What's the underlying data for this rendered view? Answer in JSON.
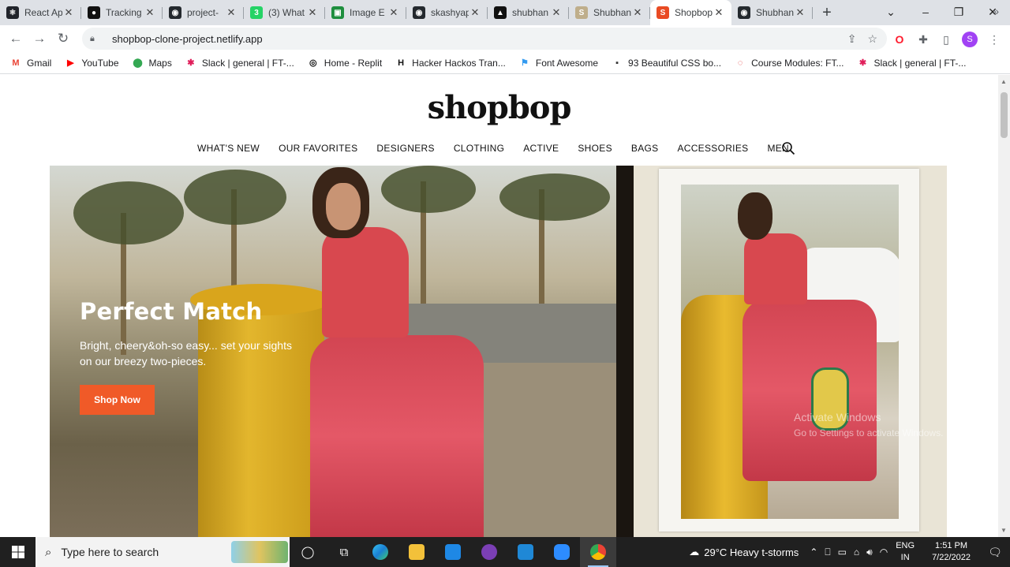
{
  "browser": {
    "tabs": [
      {
        "title": "React App",
        "color": "#20232a",
        "glyph": "⚛"
      },
      {
        "title": "Tracking",
        "color": "#111111",
        "glyph": "●"
      },
      {
        "title": "project-",
        "color": "#24292e",
        "glyph": "◉"
      },
      {
        "title": "(3) What",
        "color": "#25d366",
        "glyph": "3"
      },
      {
        "title": "Image E",
        "color": "#1e8e3e",
        "glyph": "▣"
      },
      {
        "title": "skashyap",
        "color": "#24292e",
        "glyph": "◉"
      },
      {
        "title": "shubhan",
        "color": "#111111",
        "glyph": "▲"
      },
      {
        "title": "Shubhan",
        "color": "#bfae8b",
        "glyph": "S"
      },
      {
        "title": "Shopbop",
        "color": "#e94b24",
        "glyph": "S",
        "active": true
      },
      {
        "title": "Shubhan",
        "color": "#24292e",
        "glyph": "◉"
      }
    ],
    "url": "shopbop-clone-project.netlify.app",
    "profile_initial": "S",
    "bookmarks": [
      {
        "label": "Gmail",
        "icon": "gmail-icon",
        "glyph": "M",
        "color": "#ea4335"
      },
      {
        "label": "YouTube",
        "icon": "youtube-icon",
        "glyph": "▶",
        "color": "#ff0000"
      },
      {
        "label": "Maps",
        "icon": "maps-icon",
        "glyph": "⬤",
        "color": "#34a853"
      },
      {
        "label": "Slack | general | FT-...",
        "icon": "slack-icon",
        "glyph": "✱",
        "color": "#e01e5a"
      },
      {
        "label": "Home - Replit",
        "icon": "replit-icon",
        "glyph": "◎",
        "color": "#111111"
      },
      {
        "label": "Hacker Hackos Tran...",
        "icon": "hackos-icon",
        "glyph": "H",
        "color": "#111111"
      },
      {
        "label": "Font Awesome",
        "icon": "font-awesome-icon",
        "glyph": "⚑",
        "color": "#339af0"
      },
      {
        "label": "93 Beautiful CSS bo...",
        "icon": "css-icon",
        "glyph": "▪",
        "color": "#333333"
      },
      {
        "label": "Course Modules: FT...",
        "icon": "course-icon",
        "glyph": "◌",
        "color": "#e03131"
      },
      {
        "label": "Slack | general | FT-...",
        "icon": "slack-icon",
        "glyph": "✱",
        "color": "#e01e5a"
      }
    ]
  },
  "site": {
    "logo": "shopbop",
    "nav": [
      "WHAT'S NEW",
      "OUR FAVORITES",
      "DESIGNERS",
      "CLOTHING",
      "ACTIVE",
      "SHOES",
      "BAGS",
      "ACCESSORIES",
      "MEN"
    ],
    "hero": {
      "title": "Perfect Match",
      "subtitle": "Bright, cheery&oh-so easy... set your sights on our breezy two-pieces.",
      "button": "Shop Now",
      "button_color": "#f05a28"
    }
  },
  "windows": {
    "activation_line1": "Activate Windows",
    "activation_line2": "Go to Settings to activate Windows."
  },
  "taskbar": {
    "search_placeholder": "Type here to search",
    "weather": "29°C  Heavy t-storms",
    "lang_line1": "ENG",
    "lang_line2": "IN",
    "time": "1:51 PM",
    "date": "7/22/2022"
  }
}
